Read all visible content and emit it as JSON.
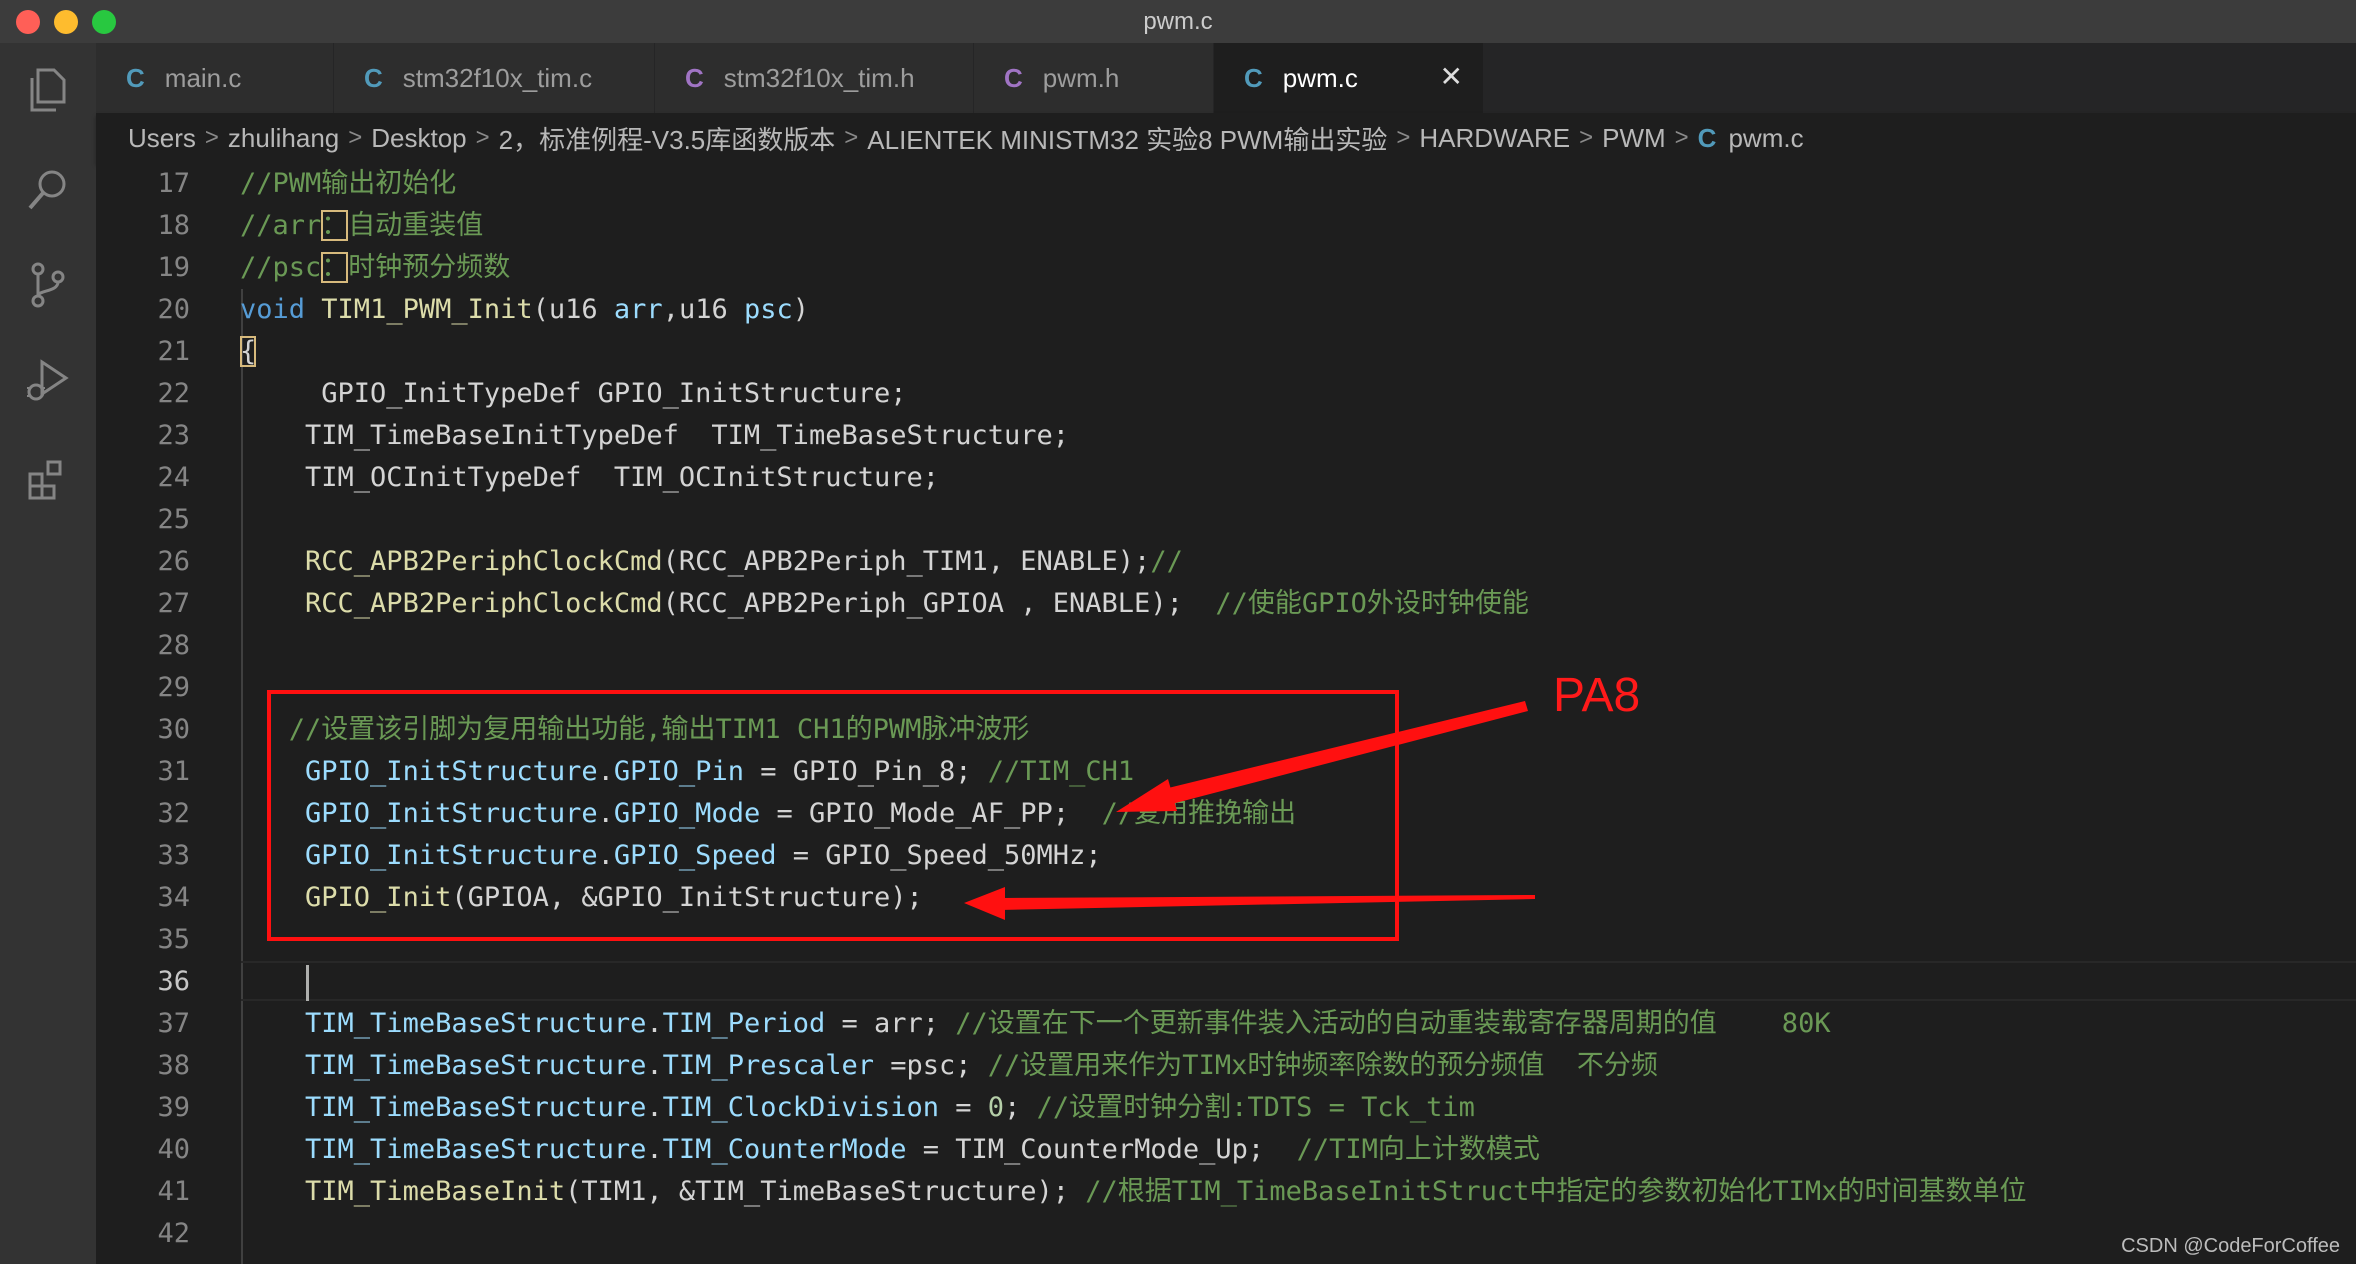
{
  "window": {
    "title": "pwm.c",
    "traffic_lights": [
      "#ff5f57",
      "#febc2e",
      "#28c840"
    ]
  },
  "activity_bar": [
    {
      "name": "explorer-icon"
    },
    {
      "name": "search-icon"
    },
    {
      "name": "source-control-icon"
    },
    {
      "name": "run-debug-icon"
    },
    {
      "name": "extensions-icon"
    }
  ],
  "tabs": [
    {
      "icon": "C",
      "icon_color": "#519aba",
      "label": "main.c",
      "active": false
    },
    {
      "icon": "C",
      "icon_color": "#519aba",
      "label": "stm32f10x_tim.c",
      "active": false
    },
    {
      "icon": "C",
      "icon_color": "#a074c4",
      "label": "stm32f10x_tim.h",
      "active": false
    },
    {
      "icon": "C",
      "icon_color": "#a074c4",
      "label": "pwm.h",
      "active": false
    },
    {
      "icon": "C",
      "icon_color": "#519aba",
      "label": "pwm.c",
      "active": true,
      "close": "✕"
    }
  ],
  "breadcrumb": {
    "items": [
      "Users",
      "zhulihang",
      "Desktop",
      "2，标准例程-V3.5库函数版本",
      "ALIENTEK MINISTM32 实验8 PWM输出实验",
      "HARDWARE",
      "PWM"
    ],
    "file_icon": "C",
    "file": "pwm.c",
    "separator": ">"
  },
  "editor": {
    "current_line": 36,
    "lines": [
      {
        "n": 17,
        "tokens": [
          [
            "c",
            "//PWM输出初始化"
          ]
        ]
      },
      {
        "n": 18,
        "tokens": [
          [
            "c",
            "//arr"
          ],
          [
            "c",
            "：",
            "hl"
          ],
          [
            "c",
            "自动重装值"
          ]
        ]
      },
      {
        "n": 19,
        "tokens": [
          [
            "c",
            "//psc"
          ],
          [
            "c",
            "：",
            "hl"
          ],
          [
            "c",
            "时钟预分频数"
          ]
        ]
      },
      {
        "n": 20,
        "tokens": [
          [
            "b",
            "void"
          ],
          [
            "w",
            " "
          ],
          [
            "y",
            "TIM1_PWM_Init"
          ],
          [
            "w",
            "(u16 "
          ],
          [
            "lb",
            "arr"
          ],
          [
            "w",
            ",u16 "
          ],
          [
            "lb",
            "psc"
          ],
          [
            "w",
            ")"
          ]
        ]
      },
      {
        "n": 21,
        "tokens": [
          [
            "w",
            "{",
            "hl"
          ]
        ]
      },
      {
        "n": 22,
        "tokens": [
          [
            "w",
            "     GPIO_InitTypeDef GPIO_InitStructure;"
          ]
        ]
      },
      {
        "n": 23,
        "tokens": [
          [
            "w",
            "    TIM_TimeBaseInitTypeDef  TIM_TimeBaseStructure;"
          ]
        ]
      },
      {
        "n": 24,
        "tokens": [
          [
            "w",
            "    TIM_OCInitTypeDef  TIM_OCInitStructure;"
          ]
        ]
      },
      {
        "n": 25,
        "tokens": []
      },
      {
        "n": 26,
        "tokens": [
          [
            "w",
            "    "
          ],
          [
            "y",
            "RCC_APB2PeriphClockCmd"
          ],
          [
            "w",
            "(RCC_APB2Periph_TIM1, ENABLE);"
          ],
          [
            "c",
            "//"
          ]
        ]
      },
      {
        "n": 27,
        "tokens": [
          [
            "w",
            "    "
          ],
          [
            "y",
            "RCC_APB2PeriphClockCmd"
          ],
          [
            "w",
            "(RCC_APB2Periph_GPIOA , ENABLE);  "
          ],
          [
            "c",
            "//使能GPIO外设时钟使能"
          ]
        ]
      },
      {
        "n": 28,
        "tokens": []
      },
      {
        "n": 29,
        "tokens": []
      },
      {
        "n": 30,
        "tokens": [
          [
            "w",
            "   "
          ],
          [
            "c",
            "//设置该引脚为复用输出功能,输出TIM1 CH1的PWM脉冲波形"
          ]
        ]
      },
      {
        "n": 31,
        "tokens": [
          [
            "w",
            "    "
          ],
          [
            "lb",
            "GPIO_InitStructure"
          ],
          [
            "w",
            "."
          ],
          [
            "lb",
            "GPIO_Pin"
          ],
          [
            "w",
            " = GPIO_Pin_8; "
          ],
          [
            "c",
            "//TIM_CH1"
          ]
        ]
      },
      {
        "n": 32,
        "tokens": [
          [
            "w",
            "    "
          ],
          [
            "lb",
            "GPIO_InitStructure"
          ],
          [
            "w",
            "."
          ],
          [
            "lb",
            "GPIO_Mode"
          ],
          [
            "w",
            " = GPIO_Mode_AF_PP;  "
          ],
          [
            "c",
            "//复用推挽输出"
          ]
        ]
      },
      {
        "n": 33,
        "tokens": [
          [
            "w",
            "    "
          ],
          [
            "lb",
            "GPIO_InitStructure"
          ],
          [
            "w",
            "."
          ],
          [
            "lb",
            "GPIO_Speed"
          ],
          [
            "w",
            " = GPIO_Speed_50MHz;"
          ]
        ]
      },
      {
        "n": 34,
        "tokens": [
          [
            "w",
            "    "
          ],
          [
            "y",
            "GPIO_Init"
          ],
          [
            "w",
            "(GPIOA, &GPIO_InitStructure);"
          ]
        ]
      },
      {
        "n": 35,
        "tokens": []
      },
      {
        "n": 36,
        "tokens": []
      },
      {
        "n": 37,
        "tokens": [
          [
            "w",
            "    "
          ],
          [
            "lb",
            "TIM_TimeBaseStructure"
          ],
          [
            "w",
            "."
          ],
          [
            "lb",
            "TIM_Period"
          ],
          [
            "w",
            " = arr; "
          ],
          [
            "c",
            "//设置在下一个更新事件装入活动的自动重装载寄存器周期的值    80K"
          ]
        ]
      },
      {
        "n": 38,
        "tokens": [
          [
            "w",
            "    "
          ],
          [
            "lb",
            "TIM_TimeBaseStructure"
          ],
          [
            "w",
            "."
          ],
          [
            "lb",
            "TIM_Prescaler"
          ],
          [
            "w",
            " =psc; "
          ],
          [
            "c",
            "//设置用来作为TIMx时钟频率除数的预分频值  不分频"
          ]
        ]
      },
      {
        "n": 39,
        "tokens": [
          [
            "w",
            "    "
          ],
          [
            "lb",
            "TIM_TimeBaseStructure"
          ],
          [
            "w",
            "."
          ],
          [
            "lb",
            "TIM_ClockDivision"
          ],
          [
            "w",
            " = "
          ],
          [
            "n",
            "0"
          ],
          [
            "w",
            "; "
          ],
          [
            "c",
            "//设置时钟分割:TDTS = Tck_tim"
          ]
        ]
      },
      {
        "n": 40,
        "tokens": [
          [
            "w",
            "    "
          ],
          [
            "lb",
            "TIM_TimeBaseStructure"
          ],
          [
            "w",
            "."
          ],
          [
            "lb",
            "TIM_CounterMode"
          ],
          [
            "w",
            " = TIM_CounterMode_Up;  "
          ],
          [
            "c",
            "//TIM向上计数模式"
          ]
        ]
      },
      {
        "n": 41,
        "tokens": [
          [
            "w",
            "    "
          ],
          [
            "y",
            "TIM_TimeBaseInit"
          ],
          [
            "w",
            "(TIM1, &TIM_TimeBaseStructure); "
          ],
          [
            "c",
            "//根据TIM_TimeBaseInitStruct中指定的参数初始化TIMx的时间基数单位"
          ]
        ]
      },
      {
        "n": 42,
        "tokens": []
      }
    ]
  },
  "annotation": {
    "label": "PA8",
    "color": "#ff1a1a"
  },
  "watermark": "CSDN @CodeForCoffee"
}
